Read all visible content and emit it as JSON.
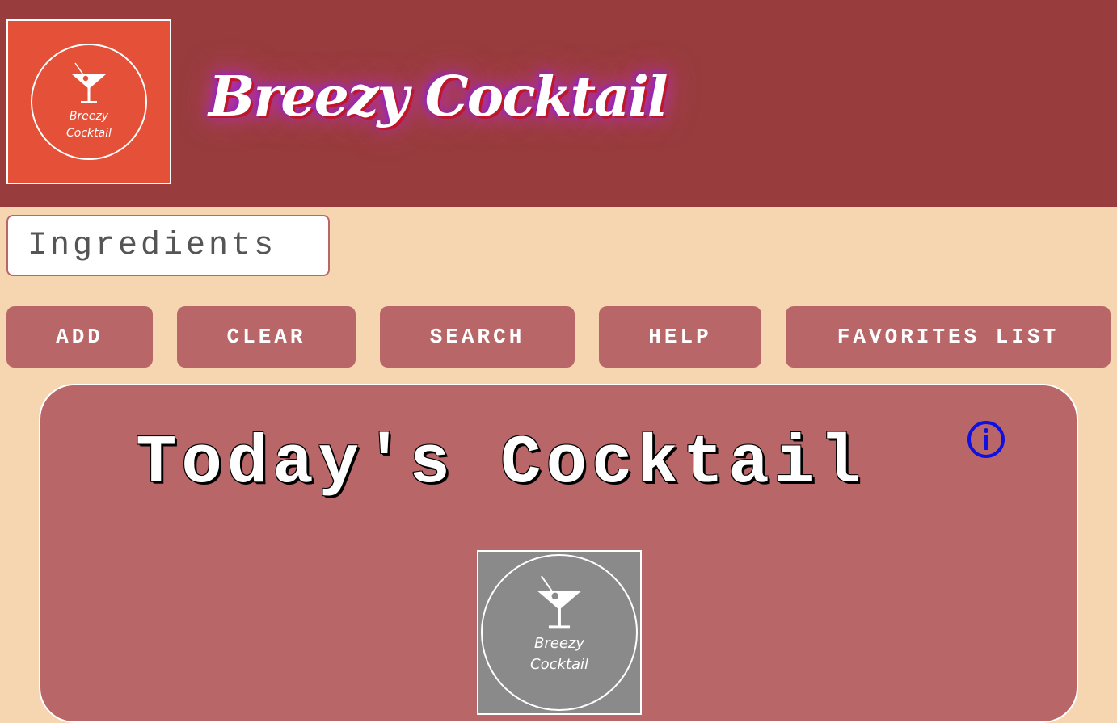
{
  "header": {
    "logo": {
      "icon": "cocktail-glass-icon",
      "line1": "Breezy",
      "line2": "Cocktail"
    },
    "title": "Breezy Cocktail"
  },
  "search": {
    "placeholder": "Ingredients"
  },
  "buttons": {
    "add": "ADD",
    "clear": "CLEAR",
    "search": "SEARCH",
    "help": "HELP",
    "favorites": "FAVORITES LIST"
  },
  "card": {
    "title": "Today's Cocktail",
    "info_icon": "info-icon",
    "image": {
      "icon": "cocktail-glass-icon",
      "line1": "Breezy",
      "line2": "Cocktail"
    }
  },
  "colors": {
    "header_bg": "#983c3e",
    "page_bg": "#f6d6b0",
    "accent": "#b86668",
    "logo_bg": "#e45138",
    "info_icon": "#1010e0",
    "placeholder_image_bg": "#8a8a8a"
  }
}
